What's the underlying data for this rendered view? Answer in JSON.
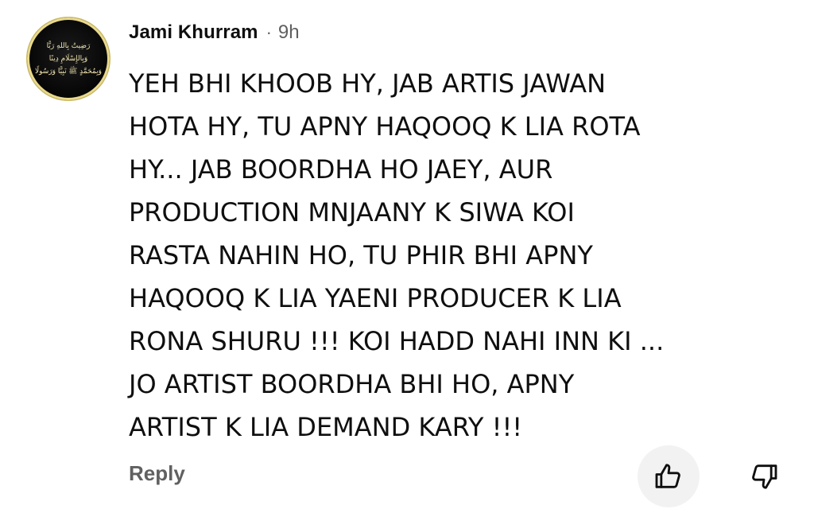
{
  "comment": {
    "author": "Jami Khurram",
    "separator": "·",
    "time": "9h",
    "avatar": {
      "lines": [
        "رَضِيتُ بِاللهِ رَبًّا",
        "وَبِالإِسْلَامِ دِينًا",
        "وَبِمُحَمَّدٍ ﷺ نَبِيًّا وَرَسُولًا"
      ]
    },
    "text_lines": [
      "YEH BHI KHOOB HY, JAB ARTIS JAWAN",
      "HOTA HY, TU APNY HAQOOQ K LIA ROTA",
      "HY... JAB BOORDHA HO JAEY, AUR",
      "PRODUCTION MNJAANY K SIWA KOI",
      "RASTA NAHIN HO, TU PHIR BHI APNY",
      "HAQOOQ K LIA YAENI PRODUCER K LIA",
      "RONA SHURU !!! KOI HADD NAHI INN KI ...",
      "JO ARTIST BOORDHA BHI HO, APNY",
      "ARTIST K LIA DEMAND KARY !!!"
    ]
  },
  "actions": {
    "reply_label": "Reply",
    "like_icon": "thumbs-up-icon",
    "dislike_icon": "thumbs-down-icon"
  },
  "colors": {
    "text": "#0f0f0f",
    "secondary": "#606060",
    "like_bg": "#f2f2f2",
    "avatar_bg": "#000000",
    "avatar_text": "#f3e7b0"
  }
}
